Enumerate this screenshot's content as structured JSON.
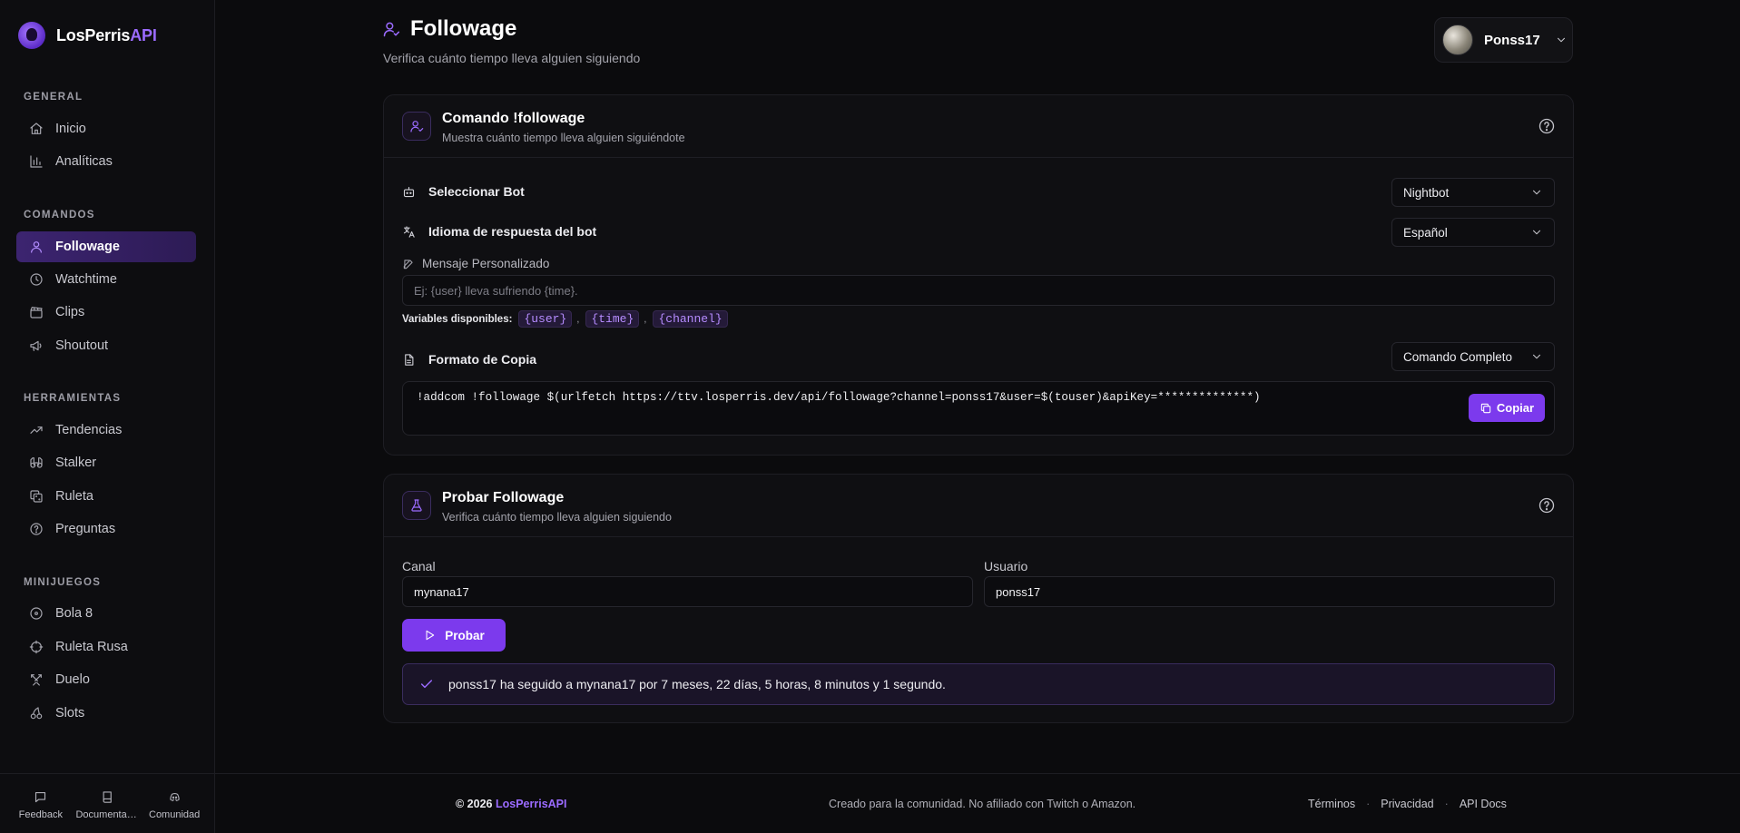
{
  "brand": {
    "name": "LosPerris",
    "accent": "API"
  },
  "sidebar": {
    "sections": [
      {
        "title": "GENERAL",
        "items": [
          {
            "label": "Inicio",
            "icon": "home-icon"
          },
          {
            "label": "Analíticas",
            "icon": "bar-chart-icon"
          }
        ]
      },
      {
        "title": "COMANDOS",
        "items": [
          {
            "label": "Followage",
            "icon": "user-icon",
            "active": true
          },
          {
            "label": "Watchtime",
            "icon": "clock-icon"
          },
          {
            "label": "Clips",
            "icon": "clapper-icon"
          },
          {
            "label": "Shoutout",
            "icon": "megaphone-icon"
          }
        ]
      },
      {
        "title": "HERRAMIENTAS",
        "items": [
          {
            "label": "Tendencias",
            "icon": "trending-icon"
          },
          {
            "label": "Stalker",
            "icon": "binoculars-icon"
          },
          {
            "label": "Ruleta",
            "icon": "dice-icon"
          },
          {
            "label": "Preguntas",
            "icon": "question-icon"
          }
        ]
      },
      {
        "title": "MINIJUEGOS",
        "items": [
          {
            "label": "Bola 8",
            "icon": "target-icon"
          },
          {
            "label": "Ruleta Rusa",
            "icon": "crosshair-icon"
          },
          {
            "label": "Duelo",
            "icon": "swords-icon"
          },
          {
            "label": "Slots",
            "icon": "cherries-icon"
          }
        ]
      }
    ],
    "footer": [
      {
        "label": "Feedback",
        "icon": "chat-icon"
      },
      {
        "label": "Documentación",
        "icon": "book-icon"
      },
      {
        "label": "Comunidad",
        "icon": "discord-icon"
      }
    ]
  },
  "header": {
    "title": "Followage",
    "subtitle": "Verifica cuánto tiempo lleva alguien siguiendo",
    "user": "Ponss17"
  },
  "command_card": {
    "title": "Comando !followage",
    "subtitle": "Muestra cuánto tiempo lleva alguien siguiéndote",
    "bot_label": "Seleccionar Bot",
    "bot_value": "Nightbot",
    "lang_label": "Idioma de respuesta del bot",
    "lang_value": "Español",
    "message_label": "Mensaje Personalizado",
    "message_placeholder": "Ej: {user} lleva sufriendo {time}.",
    "message_value": "",
    "vars_label": "Variables disponibles:",
    "vars": [
      "{user}",
      "{time}",
      "{channel}"
    ],
    "format_label": "Formato de Copia",
    "format_value": "Comando Completo",
    "command": "!addcom !followage $(urlfetch https://ttv.losperris.dev/api/followage?channel=ponss17&user=$(touser)&apiKey=**************)",
    "copy_label": "Copiar"
  },
  "test_card": {
    "title": "Probar Followage",
    "subtitle": "Verifica cuánto tiempo lleva alguien siguiendo",
    "channel_label": "Canal",
    "channel_value": "mynana17",
    "user_label": "Usuario",
    "user_value": "ponss17",
    "button_label": "Probar",
    "result": "ponss17 ha seguido a mynana17 por 7 meses, 22 días, 5 horas, 8 minutos y 1 segundo."
  },
  "footer": {
    "year": "© 2026",
    "brand": "LosPerrisAPI",
    "tagline": "Creado para la comunidad. No afiliado con Twitch o Amazon.",
    "links": [
      "Términos",
      "Privacidad",
      "API Docs"
    ]
  },
  "colors": {
    "accent": "#7c3aed",
    "accent_light": "#9b6bff",
    "background": "#0b0b0d",
    "card": "#0f0f12"
  }
}
